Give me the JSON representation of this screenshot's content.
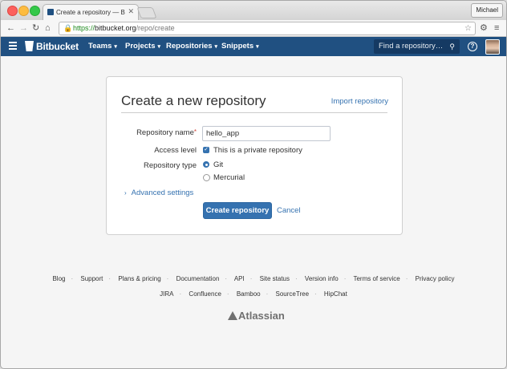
{
  "browser": {
    "tab_title": "Create a repository — Bitbucket",
    "user_button": "Michael",
    "url_scheme": "https://",
    "url_host": "bitbucket.org",
    "url_path": "/repo/create"
  },
  "header": {
    "logo": "Bitbucket",
    "nav": [
      "Teams",
      "Projects",
      "Repositories",
      "Snippets"
    ],
    "search_placeholder": "Find a repository…",
    "help": "?"
  },
  "form": {
    "title": "Create a new repository",
    "import_link": "Import repository",
    "name_label": "Repository name",
    "name_value": "hello_app",
    "access_label": "Access level",
    "private_text": "This is a private repository",
    "private_checked": true,
    "type_label": "Repository type",
    "type_options": [
      "Git",
      "Mercurial"
    ],
    "type_selected": "Git",
    "advanced": "Advanced settings",
    "create_button": "Create repository",
    "cancel": "Cancel"
  },
  "footer": {
    "links1": [
      "Blog",
      "Support",
      "Plans & pricing",
      "Documentation",
      "API",
      "Site status",
      "Version info",
      "Terms of service",
      "Privacy policy"
    ],
    "links2": [
      "JIRA",
      "Confluence",
      "Bamboo",
      "SourceTree",
      "HipChat"
    ],
    "brand": "Atlassian"
  },
  "colors": {
    "header_bg": "#205081",
    "accent": "#3572b0",
    "required": "#d04437"
  }
}
